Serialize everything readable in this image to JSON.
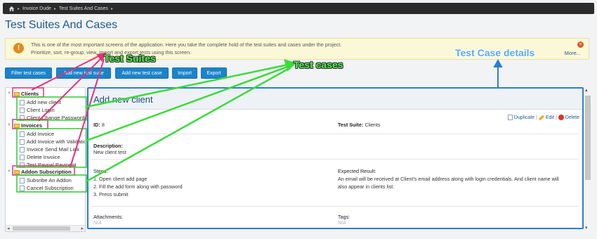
{
  "breadcrumb": {
    "items": [
      "Invoice Dude",
      "Test Suites And Cases"
    ]
  },
  "page_title": "Test Suites And Cases",
  "banner": {
    "line1": "This is one of the most important screens of the application. Here you take the complete hold of the test suites and cases under the project.",
    "line2": "Prioritize, sort, re-group, view, import and export tests using this screen.",
    "more": "More..."
  },
  "toolbar": {
    "filter": "Filter test cases",
    "add_suite": "Add new test suite",
    "add_case": "Add new test case",
    "import": "Import",
    "export": "Export"
  },
  "tree": {
    "suites": [
      {
        "name": "Clients",
        "cases": [
          "Add new client",
          "Client Login",
          "Client Change Password"
        ]
      },
      {
        "name": "Invoices",
        "cases": [
          "Add Invoice",
          "Add Invoice with Validation",
          "Invoice Send Mail Link",
          "Delete Invoice",
          "Test Paypal Payment"
        ]
      },
      {
        "name": "Addon Subscription",
        "cases": [
          "Subsribe An Addon",
          "Cancel Subscription"
        ]
      }
    ]
  },
  "detail": {
    "title": "Add new client",
    "actions": {
      "duplicate": "Duplicate",
      "edit": "Edit",
      "delete": "Delete",
      "sep": "|"
    },
    "id_label": "ID:",
    "id_value": "8",
    "suite_label": "Test Suite:",
    "suite_value": "Clients",
    "description_label": "Description:",
    "description_value": "New client test",
    "steps_label": "Steps:",
    "steps": [
      "1. Open client add page",
      "2. Fill the add form along with password",
      "3. Press submit"
    ],
    "expected_label": "Expected Result:",
    "expected_line1": "An email will be received at Client's email address along with login credentials. And client name will",
    "expected_line2": "also appear in clients list.",
    "attachments_label": "Attachments:",
    "attachments_value": "N/A",
    "tags_label": "Tags:",
    "tags_value": "N/A"
  },
  "annotations": {
    "test_suites": "Test Suites",
    "test_cases": "Test cases",
    "test_case_details": "Test Case details"
  }
}
